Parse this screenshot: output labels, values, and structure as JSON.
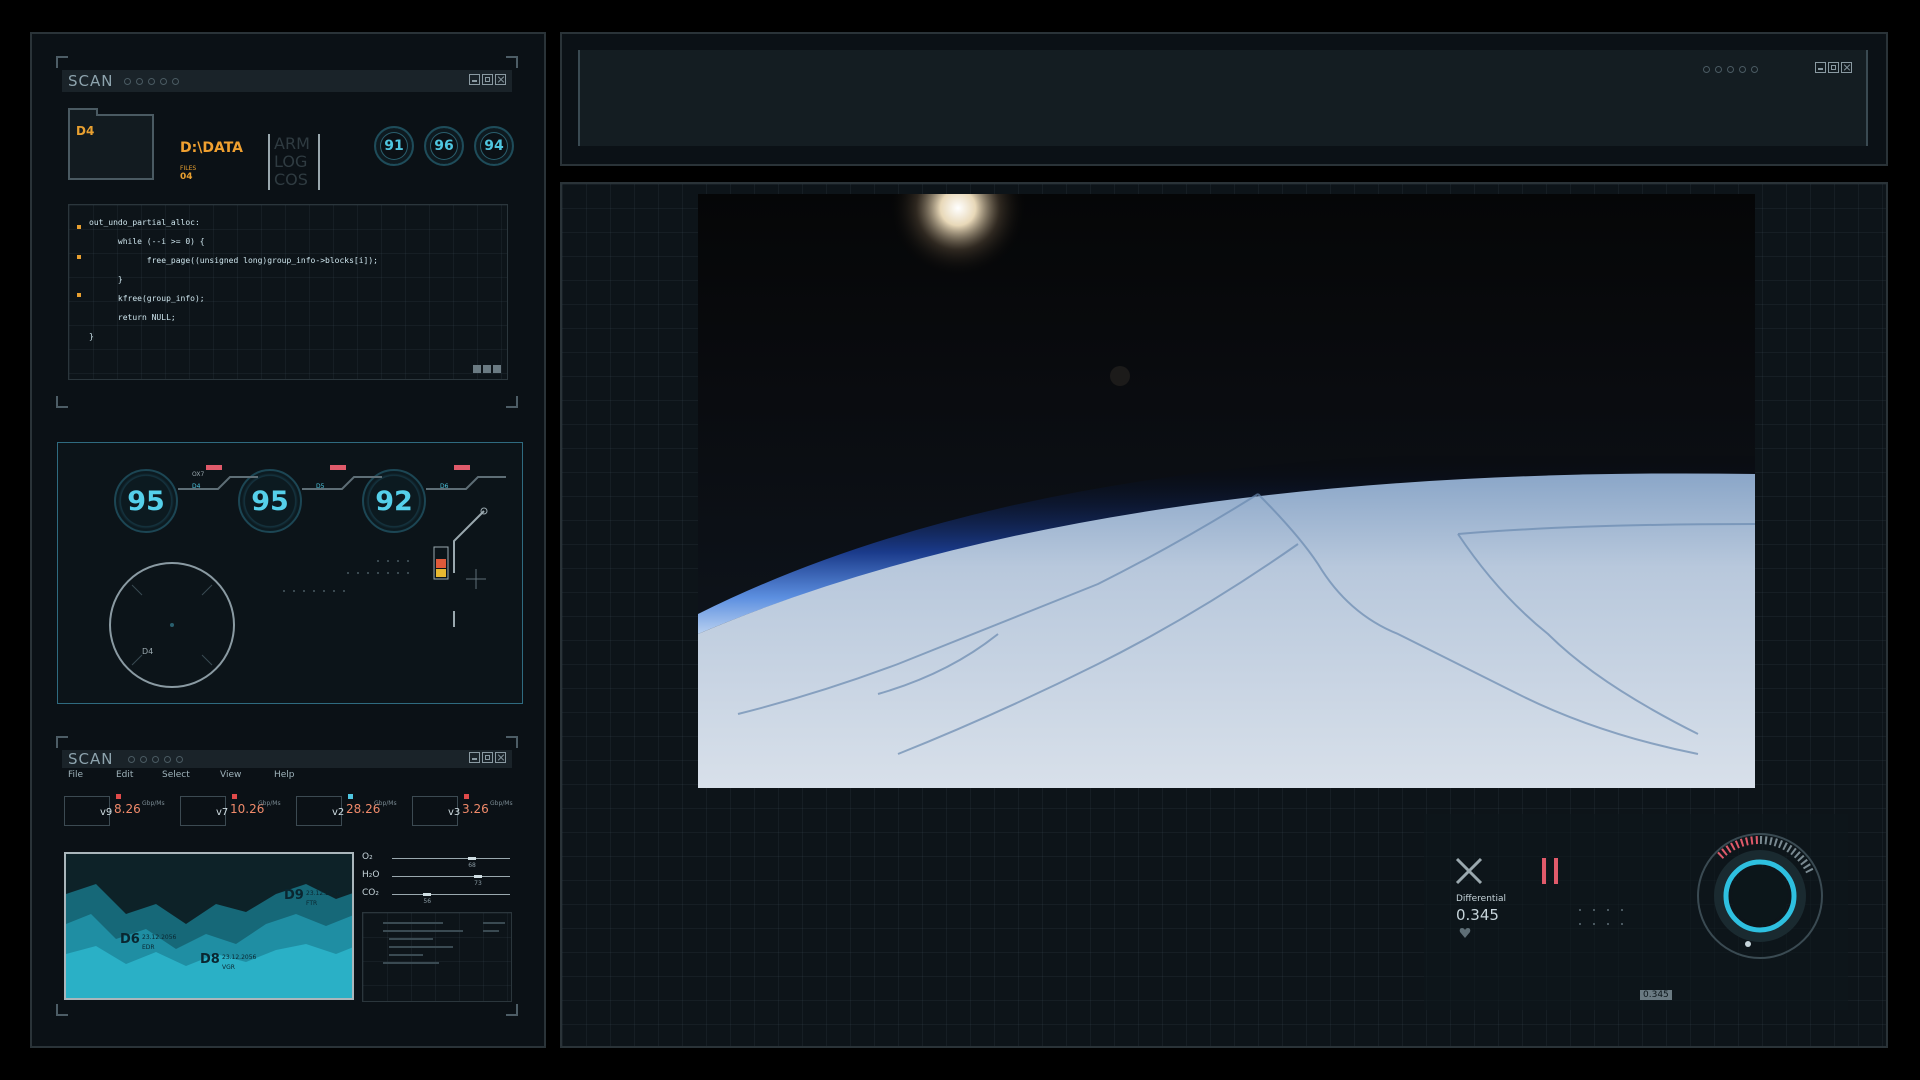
{
  "scan_window": {
    "title": "SCAN",
    "folder_label": "D4",
    "path": "D:\\DATA",
    "files_label": "FILES",
    "files_count": "04",
    "stack_labels": [
      "ARM",
      "LOG",
      "COS"
    ],
    "gauges": [
      "91",
      "96",
      "94"
    ],
    "code_lines": [
      "out_undo_partial_alloc:",
      "      while (--i >= 0) {",
      "            free_page((unsigned long)group_info->blocks[i]);",
      "      }",
      "      kfree(group_info);",
      "      return NULL;",
      "}"
    ]
  },
  "radar_panel": {
    "gauges": [
      {
        "value": "95",
        "tag": "OX7",
        "sub": "D4"
      },
      {
        "value": "95",
        "tag": "",
        "sub": "D5"
      },
      {
        "value": "92",
        "tag": "",
        "sub": "D6"
      }
    ],
    "radar_label": "D4"
  },
  "scan_window_2": {
    "title": "SCAN",
    "menu": [
      "File",
      "Edit",
      "Select",
      "View",
      "Help"
    ],
    "streams": [
      {
        "tag": "v9",
        "value": "8.26",
        "unit": "Gbp/Ms"
      },
      {
        "tag": "v7",
        "value": "10.26",
        "unit": "Gbp/Ms"
      },
      {
        "tag": "v2",
        "value": "28.26",
        "unit": "Gbp/Ms"
      },
      {
        "tag": "v3",
        "value": "3.26",
        "unit": "Gbp/Ms"
      }
    ],
    "peaks": [
      {
        "name": "D9",
        "date": "23.12.2056",
        "sub": "FTR"
      },
      {
        "name": "D6",
        "date": "23.12.2056",
        "sub": "EDR"
      },
      {
        "name": "D8",
        "date": "23.12.2056",
        "sub": "VGR"
      }
    ],
    "gases": [
      {
        "label": "O₂",
        "value": "68",
        "level": 0.68
      },
      {
        "label": "H₂O",
        "value": "73",
        "level": 0.73
      },
      {
        "label": "CO₂",
        "value": "56",
        "level": 0.3
      }
    ]
  },
  "top_window": {},
  "viewport": {
    "differential_label": "Differential",
    "differential_value": "0.345",
    "bottom_readout": "0.345"
  },
  "colors": {
    "accent": "#4fc6e0",
    "alert": "#e05a6a",
    "chart_fill": "#2aa8bf"
  }
}
